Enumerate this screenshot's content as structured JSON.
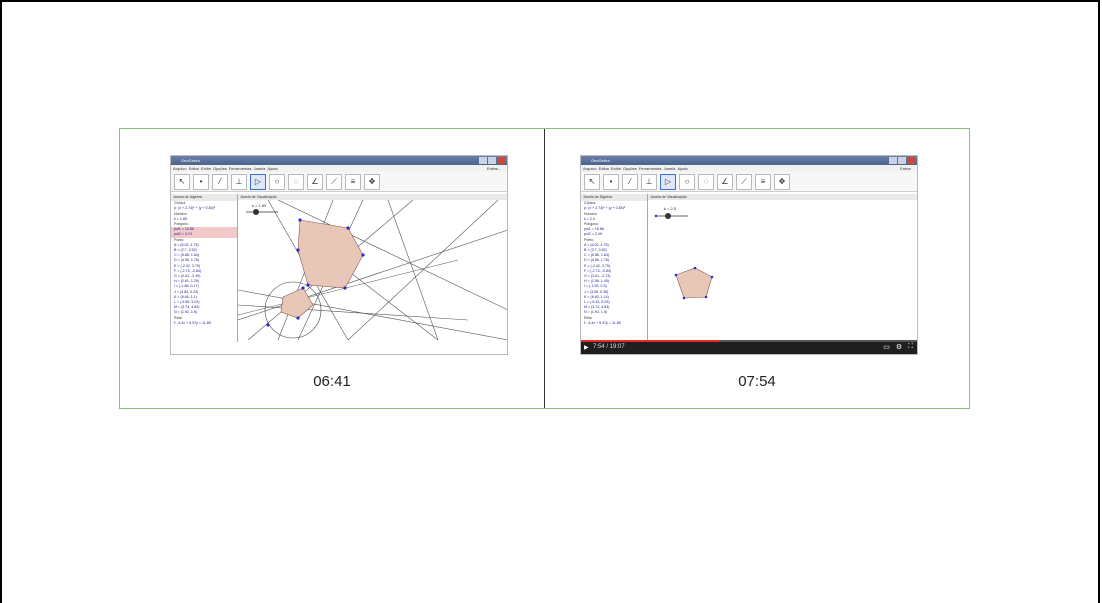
{
  "frames": [
    {
      "timestamp": "06:41",
      "app_title": "GeoGebra",
      "menu": [
        "Arquivo",
        "Editar",
        "Exibir",
        "Opções",
        "Ferramentas",
        "Janela",
        "Ajuda"
      ],
      "entrar": "Entrar...",
      "algebra_header": "Janela de Álgebra",
      "graphics_header": "Janela de Visualização",
      "slider_label": "k = 1.85",
      "algebra_items": [
        "Cônica",
        "p: (x + 2.74)² + (y + 0.84)²",
        "Número",
        "k = 1.85",
        "Polígono",
        "pol1 = 15.86",
        "pol2 = 3.74",
        "Ponto",
        "A = (6.02, 4.75)",
        "B = (2.7, 3.52)",
        "C = (5.86, 1.64)",
        "D = (4.96, 1.76)",
        "E = (-2.42, 3.79)",
        "F = (-2.74, -0.84)",
        "G = (2.61, -2.49)",
        "H = (2.61, 1.29)",
        "I = (-1.86, 0.17)",
        "J = (3.83, 0.23)",
        "K = (6.46, 1.1)",
        "L = (-5.59, 5.02)",
        "M = (3.74, 4.83)",
        "N = (1.92, 1.5)",
        "Reta",
        "f: -4.4x + 5.37y = 11.85"
      ]
    },
    {
      "timestamp": "07:54",
      "app_title": "GeoGebra",
      "menu": [
        "Arquivo",
        "Editar",
        "Exibir",
        "Opções",
        "Ferramentas",
        "Janela",
        "Ajuda"
      ],
      "entrar": "Entrar",
      "algebra_header": "Janela de Álgebra",
      "graphics_header": "Janela de Visualização",
      "slider_label": "k = 2.5",
      "player_time": "7:54 / 19:07",
      "progress": 0.41,
      "algebra_items": [
        "Cônica",
        "p: (x + 2.74)² + (y + 0.84)²",
        "Número",
        "k = 2.5",
        "Polígono",
        "pol1 = 15.86",
        "pol2 = 2.49",
        "Ponto",
        "A = (6.02, 4.75)",
        "B = (2.7, 3.52)",
        "C = (5.86, 1.64)",
        "D = (4.96, 1.76)",
        "E = (-2.42, 3.79)",
        "F = (-2.74, -0.84)",
        "G = (2.61, -2.73)",
        "H = (2.56, 1.45)",
        "I = (-1.93, 0.3)",
        "J = (3.55, 0.35)",
        "K = (6.93, 1.14)",
        "L = (-5.43, 5.03)",
        "M = (3.74, 4.83)",
        "N = (1.92, 1.5)",
        "Reta",
        "f: -4.4x + 5.37y = 11.85"
      ]
    }
  ],
  "colors": {
    "border_green": "#8dbf7a",
    "polygon_fill": "#e8c7b8",
    "point_blue": "#2b2bd0"
  }
}
